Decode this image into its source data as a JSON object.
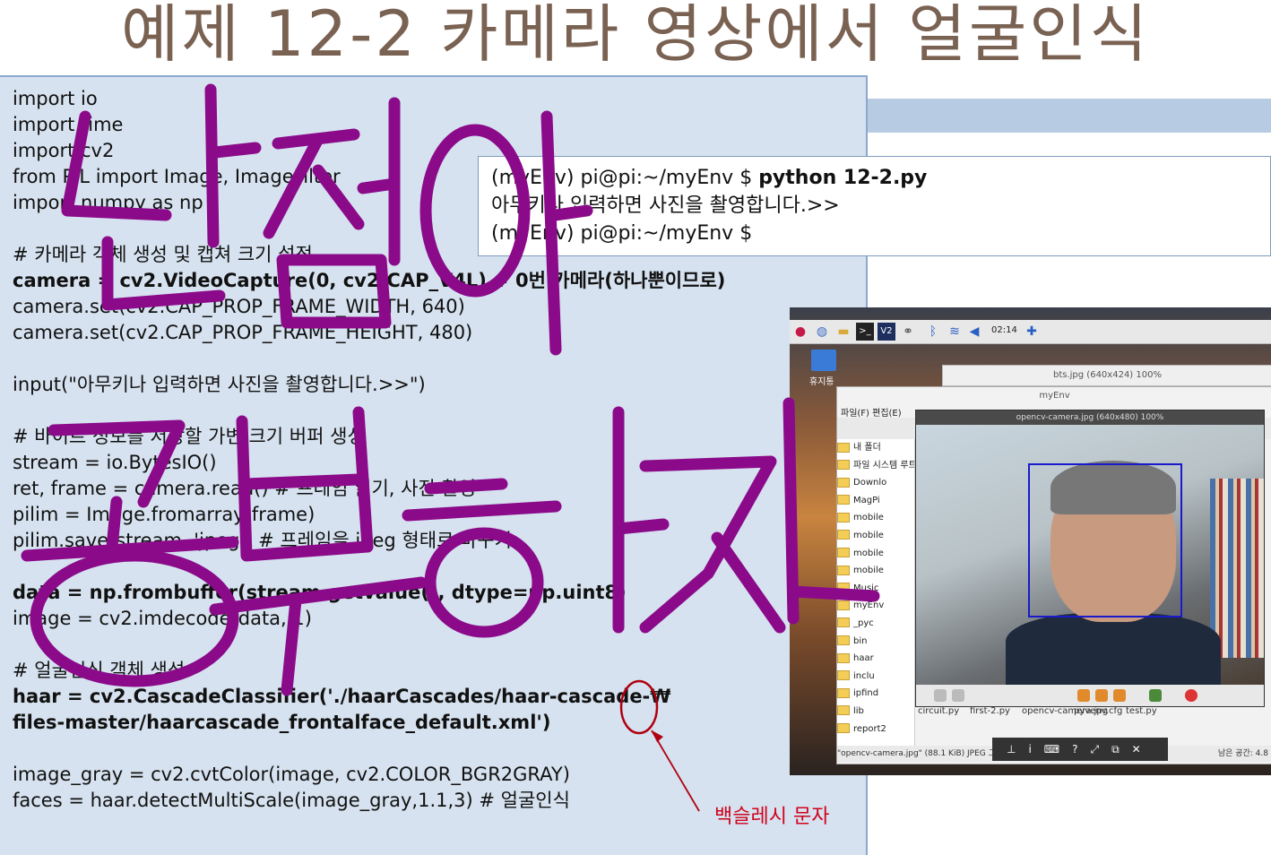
{
  "title": "예제 12-2 카메라 영상에서 얼굴인식",
  "code_lines": [
    {
      "text": "import io",
      "bold": false
    },
    {
      "text": "import time",
      "bold": false
    },
    {
      "text": "import cv2",
      "bold": false
    },
    {
      "text": "from PIL import Image, ImageFilter",
      "bold": false
    },
    {
      "text": "import numpy as np",
      "bold": false
    },
    {
      "text": "",
      "bold": false
    },
    {
      "text": "# 카메라 객체 생성 및 캡쳐 크기 설정",
      "bold": false
    },
    {
      "text": "camera = cv2.VideoCapture(0, cv2.CAP_V4L) # 0번 카메라(하나뿐이므로)",
      "bold": true
    },
    {
      "text": "camera.set(cv2.CAP_PROP_FRAME_WIDTH, 640)",
      "bold": false
    },
    {
      "text": "camera.set(cv2.CAP_PROP_FRAME_HEIGHT, 480)",
      "bold": false
    },
    {
      "text": "",
      "bold": false
    },
    {
      "text": "input(\"아무키나 입력하면 사진을 촬영합니다.>>\")",
      "bold": false
    },
    {
      "text": "",
      "bold": false
    },
    {
      "text": "# 바이트 정보를 저장할 가변 크기 버퍼 생성",
      "bold": false
    },
    {
      "text": "stream = io.BytesIO()",
      "bold": false
    },
    {
      "text": "ret, frame = camera.read() # 프레임 읽기, 사진 촬영",
      "bold": false
    },
    {
      "text": "pilim = Image.fromarray(frame)",
      "bold": false
    },
    {
      "text": "pilim.save(stream, 'jpeg') # 프레임을 jpeg 형태로 바꾸기",
      "bold": false
    },
    {
      "text": "",
      "bold": false
    },
    {
      "text": "data = np.frombuffer(stream.getvalue(), dtype=np.uint8)",
      "bold": true
    },
    {
      "text": "image = cv2.imdecode(data, 1)",
      "bold": false
    },
    {
      "text": "",
      "bold": false
    },
    {
      "text": "# 얼굴인식 객체 생성",
      "bold": false
    },
    {
      "text": "haar = cv2.CascadeClassifier('./haarCascades/haar-cascade-₩",
      "bold": true
    },
    {
      "text": "files-master/haarcascade_frontalface_default.xml')",
      "bold": true
    },
    {
      "text": "",
      "bold": false
    },
    {
      "text": "image_gray = cv2.cvtColor(image, cv2.COLOR_BGR2GRAY)",
      "bold": false
    },
    {
      "text": "faces = haar.detectMultiScale(image_gray,1.1,3) # 얼굴인식",
      "bold": false
    }
  ],
  "terminal": {
    "line1_prompt": "(myEnv) pi@pi:~/myEnv $ ",
    "line1_cmd": "python 12-2.py",
    "line2": "아무키나 입력하면 사진을 촬영합니다.>>",
    "line3": "(myEnv) pi@pi:~/myEnv $"
  },
  "desktop": {
    "clock": "02:14",
    "trash_label": "휴지통",
    "bg_window_title": "bts.jpg (640x424) 100%",
    "file_manager": {
      "title": "myEnv",
      "menu": "파일(F)  편집(E)",
      "sidebar": [
        "내 폴더",
        "파일 시스템 루트",
        "Downlo",
        "MagPi",
        "mobile",
        "mobile",
        "mobile",
        "mobile",
        "Music",
        "myEnv",
        "_pyc",
        "bin",
        "haar",
        "inclu",
        "ipfind",
        "lib",
        "report2"
      ],
      "files": [
        "circuit.py",
        "first-2.py",
        "opencv-camera.jpg",
        "pyvenv.cfg",
        "test.py"
      ],
      "status_left": "\"opencv-camera.jpg\" (88.1 KiB) JPEG 그림",
      "status_right": "남은 공간: 4.8"
    },
    "viewer_title": "opencv-camera.jpg (640x480) 100%"
  },
  "annotation_label": "백슬레시 문자",
  "colors": {
    "title": "#7a6253",
    "code_bg": "#d6e2ef",
    "handwriting": "#8b0a8a",
    "annotation": "#d0021b",
    "face_box": "#1a1acc"
  }
}
